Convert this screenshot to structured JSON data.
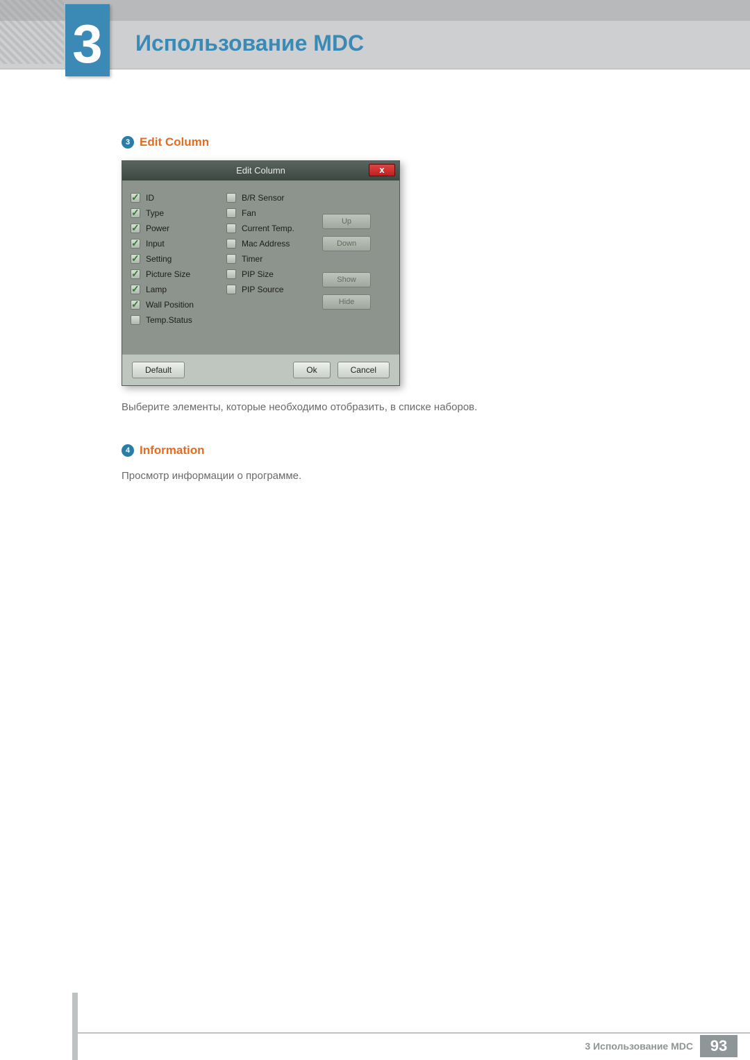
{
  "chapter": {
    "number": "3",
    "title": "Использование MDC"
  },
  "section3": {
    "bullet": "3",
    "title": "Edit Column",
    "dialog": {
      "title": "Edit Column",
      "close": "x",
      "checks_col1": [
        {
          "label": "ID",
          "checked": true
        },
        {
          "label": "Type",
          "checked": true
        },
        {
          "label": "Power",
          "checked": true
        },
        {
          "label": "Input",
          "checked": true
        },
        {
          "label": "Setting",
          "checked": true
        },
        {
          "label": "Picture Size",
          "checked": true
        },
        {
          "label": "Lamp",
          "checked": true
        },
        {
          "label": "Wall Position",
          "checked": true
        },
        {
          "label": "Temp.Status",
          "checked": false
        }
      ],
      "checks_col2": [
        {
          "label": "B/R Sensor",
          "checked": false
        },
        {
          "label": "Fan",
          "checked": false
        },
        {
          "label": "Current Temp.",
          "checked": false
        },
        {
          "label": "Mac Address",
          "checked": false
        },
        {
          "label": "Timer",
          "checked": false
        },
        {
          "label": "PIP Size",
          "checked": false
        },
        {
          "label": "PIP Source",
          "checked": false
        }
      ],
      "side_buttons": {
        "up": "Up",
        "down": "Down",
        "show": "Show",
        "hide": "Hide"
      },
      "footer": {
        "default": "Default",
        "ok": "Ok",
        "cancel": "Cancel"
      }
    },
    "caption": "Выберите элементы, которые необходимо отобразить, в списке наборов."
  },
  "section4": {
    "bullet": "4",
    "title": "Information",
    "body": "Просмотр информации о программе."
  },
  "footer": {
    "text": "3 Использование MDC",
    "page": "93"
  }
}
